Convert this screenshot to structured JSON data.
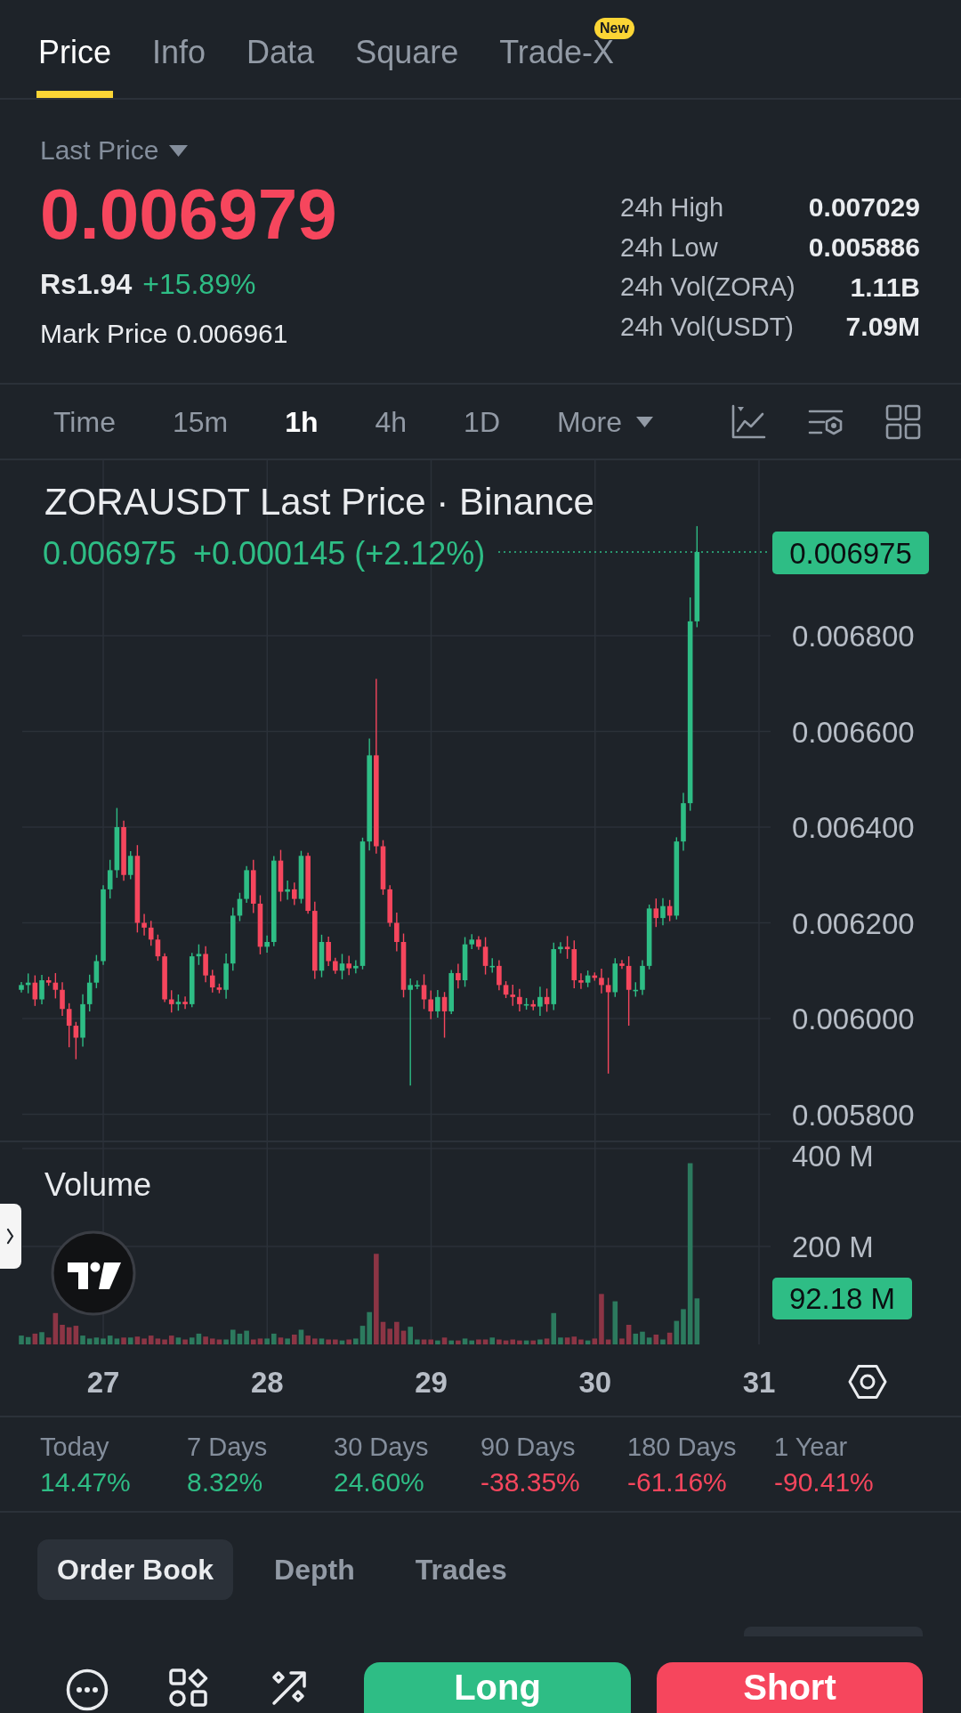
{
  "tabs": [
    {
      "label": "Price",
      "selected": true
    },
    {
      "label": "Info",
      "selected": false
    },
    {
      "label": "Data",
      "selected": false
    },
    {
      "label": "Square",
      "selected": false
    },
    {
      "label": "Trade-X",
      "selected": false,
      "badge": "New"
    }
  ],
  "header": {
    "selector": "Last Price",
    "last_price": "0.006979",
    "last_price_up": false,
    "fiat_price": "Rs1.94",
    "change": {
      "text": "+15.89%",
      "up": true
    },
    "mark_price_label": "Mark Price",
    "mark_price": "0.006961",
    "stats": [
      {
        "label": "24h High",
        "value": "0.007029"
      },
      {
        "label": "24h Low",
        "value": "0.005886"
      },
      {
        "label": "24h Vol(ZORA)",
        "value": "1.11B"
      },
      {
        "label": "24h Vol(USDT)",
        "value": "7.09M"
      }
    ]
  },
  "intervals": [
    {
      "label": "Time",
      "kind": "option",
      "selected": false
    },
    {
      "label": "15m",
      "kind": "option",
      "selected": false
    },
    {
      "label": "1h",
      "kind": "option",
      "selected": true
    },
    {
      "label": "4h",
      "kind": "option",
      "selected": false
    },
    {
      "label": "1D",
      "kind": "option",
      "selected": false
    },
    {
      "label": "More",
      "kind": "dropdown",
      "selected": false
    }
  ],
  "chart": {
    "title": "ZORAUSDT Last Price · Binance",
    "legend_price": "0.006975",
    "legend_change": "+0.000145 (+2.12%)",
    "price_tag": "0.006975",
    "price_ticks": [
      "0.006800",
      "0.006600",
      "0.006400",
      "0.006200",
      "0.006000",
      "0.005800"
    ],
    "volume_title": "Volume",
    "volume_ticks": [
      "400 M",
      "200 M"
    ],
    "volume_tag": "92.18 M",
    "date_ticks": [
      "27",
      "28",
      "29",
      "30",
      "31"
    ]
  },
  "performance": [
    {
      "period": "Today",
      "change": "14.47%",
      "color": "#2ebd85"
    },
    {
      "period": "7 Days",
      "change": "8.32%",
      "color": "#2ebd85"
    },
    {
      "period": "30 Days",
      "change": "24.60%",
      "color": "#2ebd85"
    },
    {
      "period": "90 Days",
      "change": "-38.35%",
      "color": "#f6465d"
    },
    {
      "period": "180 Days",
      "change": "-61.16%",
      "color": "#f6465d"
    },
    {
      "period": "1 Year",
      "change": "-90.41%",
      "color": "#f6465d"
    }
  ],
  "book_tabs": [
    {
      "label": "Order Book",
      "selected": true
    },
    {
      "label": "Depth",
      "selected": false
    },
    {
      "label": "Trades",
      "selected": false
    }
  ],
  "actions": [
    {
      "label": "Long",
      "kind": "long"
    },
    {
      "label": "Short",
      "kind": "short"
    }
  ]
}
